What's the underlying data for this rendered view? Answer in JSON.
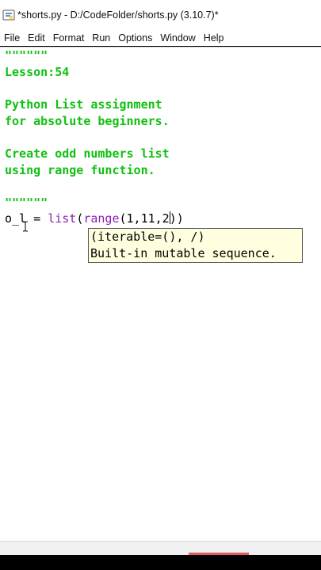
{
  "window": {
    "title": "*shorts.py - D:/CodeFolder/shorts.py (3.10.7)*"
  },
  "menu": {
    "items": [
      "File",
      "Edit",
      "Format",
      "Run",
      "Options",
      "Window",
      "Help"
    ]
  },
  "editor": {
    "lines": {
      "l1": "\"\"\"\"\"\"",
      "l2": "Lesson:54",
      "l4": "Python List assignment",
      "l5": "for absolute beginners.",
      "l7": "Create odd numbers list",
      "l8": "using range function.",
      "l10": "\"\"\"\"\"\""
    },
    "code": {
      "var": "o_l",
      "assign": " = ",
      "list_fn": "list",
      "paren1": "(",
      "range_fn": "range",
      "args_before_cursor": "(1,11,2",
      "args_after_cursor": "))"
    },
    "calltip": {
      "signature": "(iterable=(), /)",
      "description": "Built-in mutable sequence."
    }
  },
  "colors": {
    "docstring": "#10c010",
    "builtin": "#8f20b0",
    "calltip_bg": "#ffffe0"
  },
  "icons": {
    "app": "python-idle-icon",
    "text_cursor": "ibeam-cursor-icon"
  }
}
